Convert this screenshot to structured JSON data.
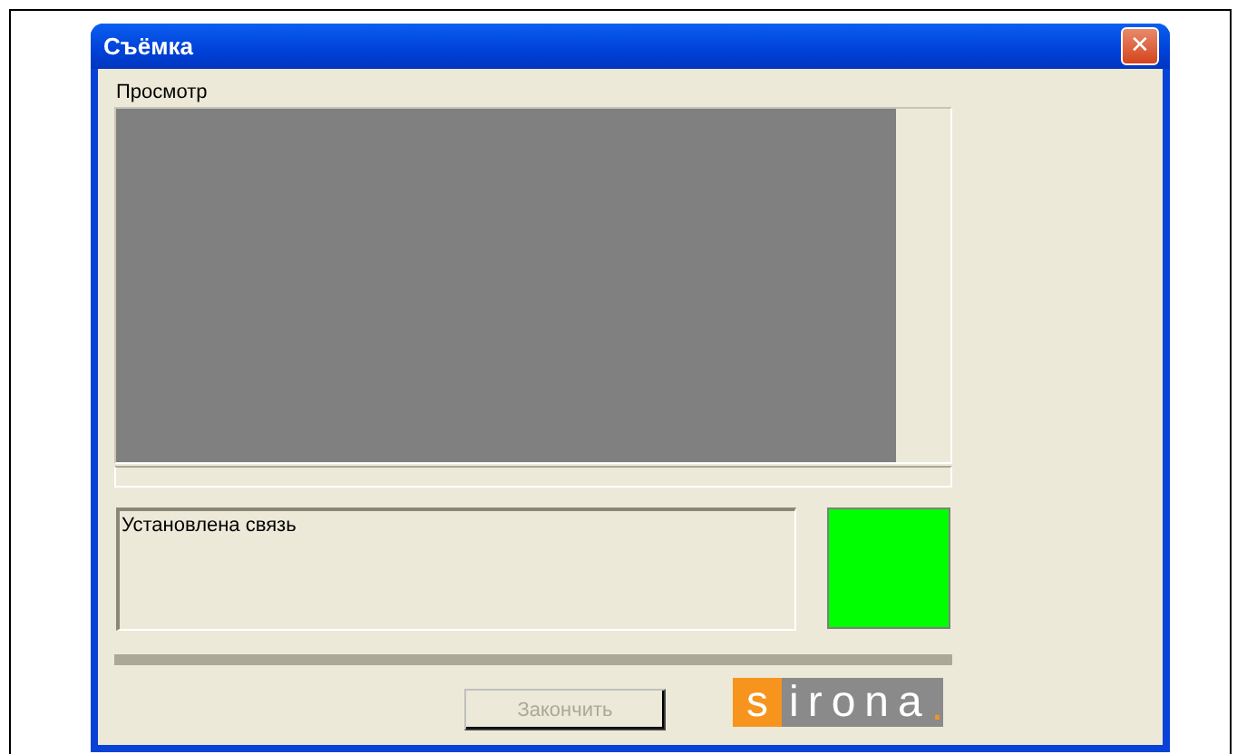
{
  "window": {
    "title": "Съёмка",
    "close_label": "✕"
  },
  "preview": {
    "label": "Просмотр"
  },
  "status": {
    "text": "Установлена связь"
  },
  "indicator": {
    "color": "#00ff00"
  },
  "progress": {
    "level": 1
  },
  "finish_button": {
    "label": "Закончить",
    "disabled": true
  },
  "logo": {
    "parts": [
      "s",
      "irona",
      "."
    ]
  }
}
